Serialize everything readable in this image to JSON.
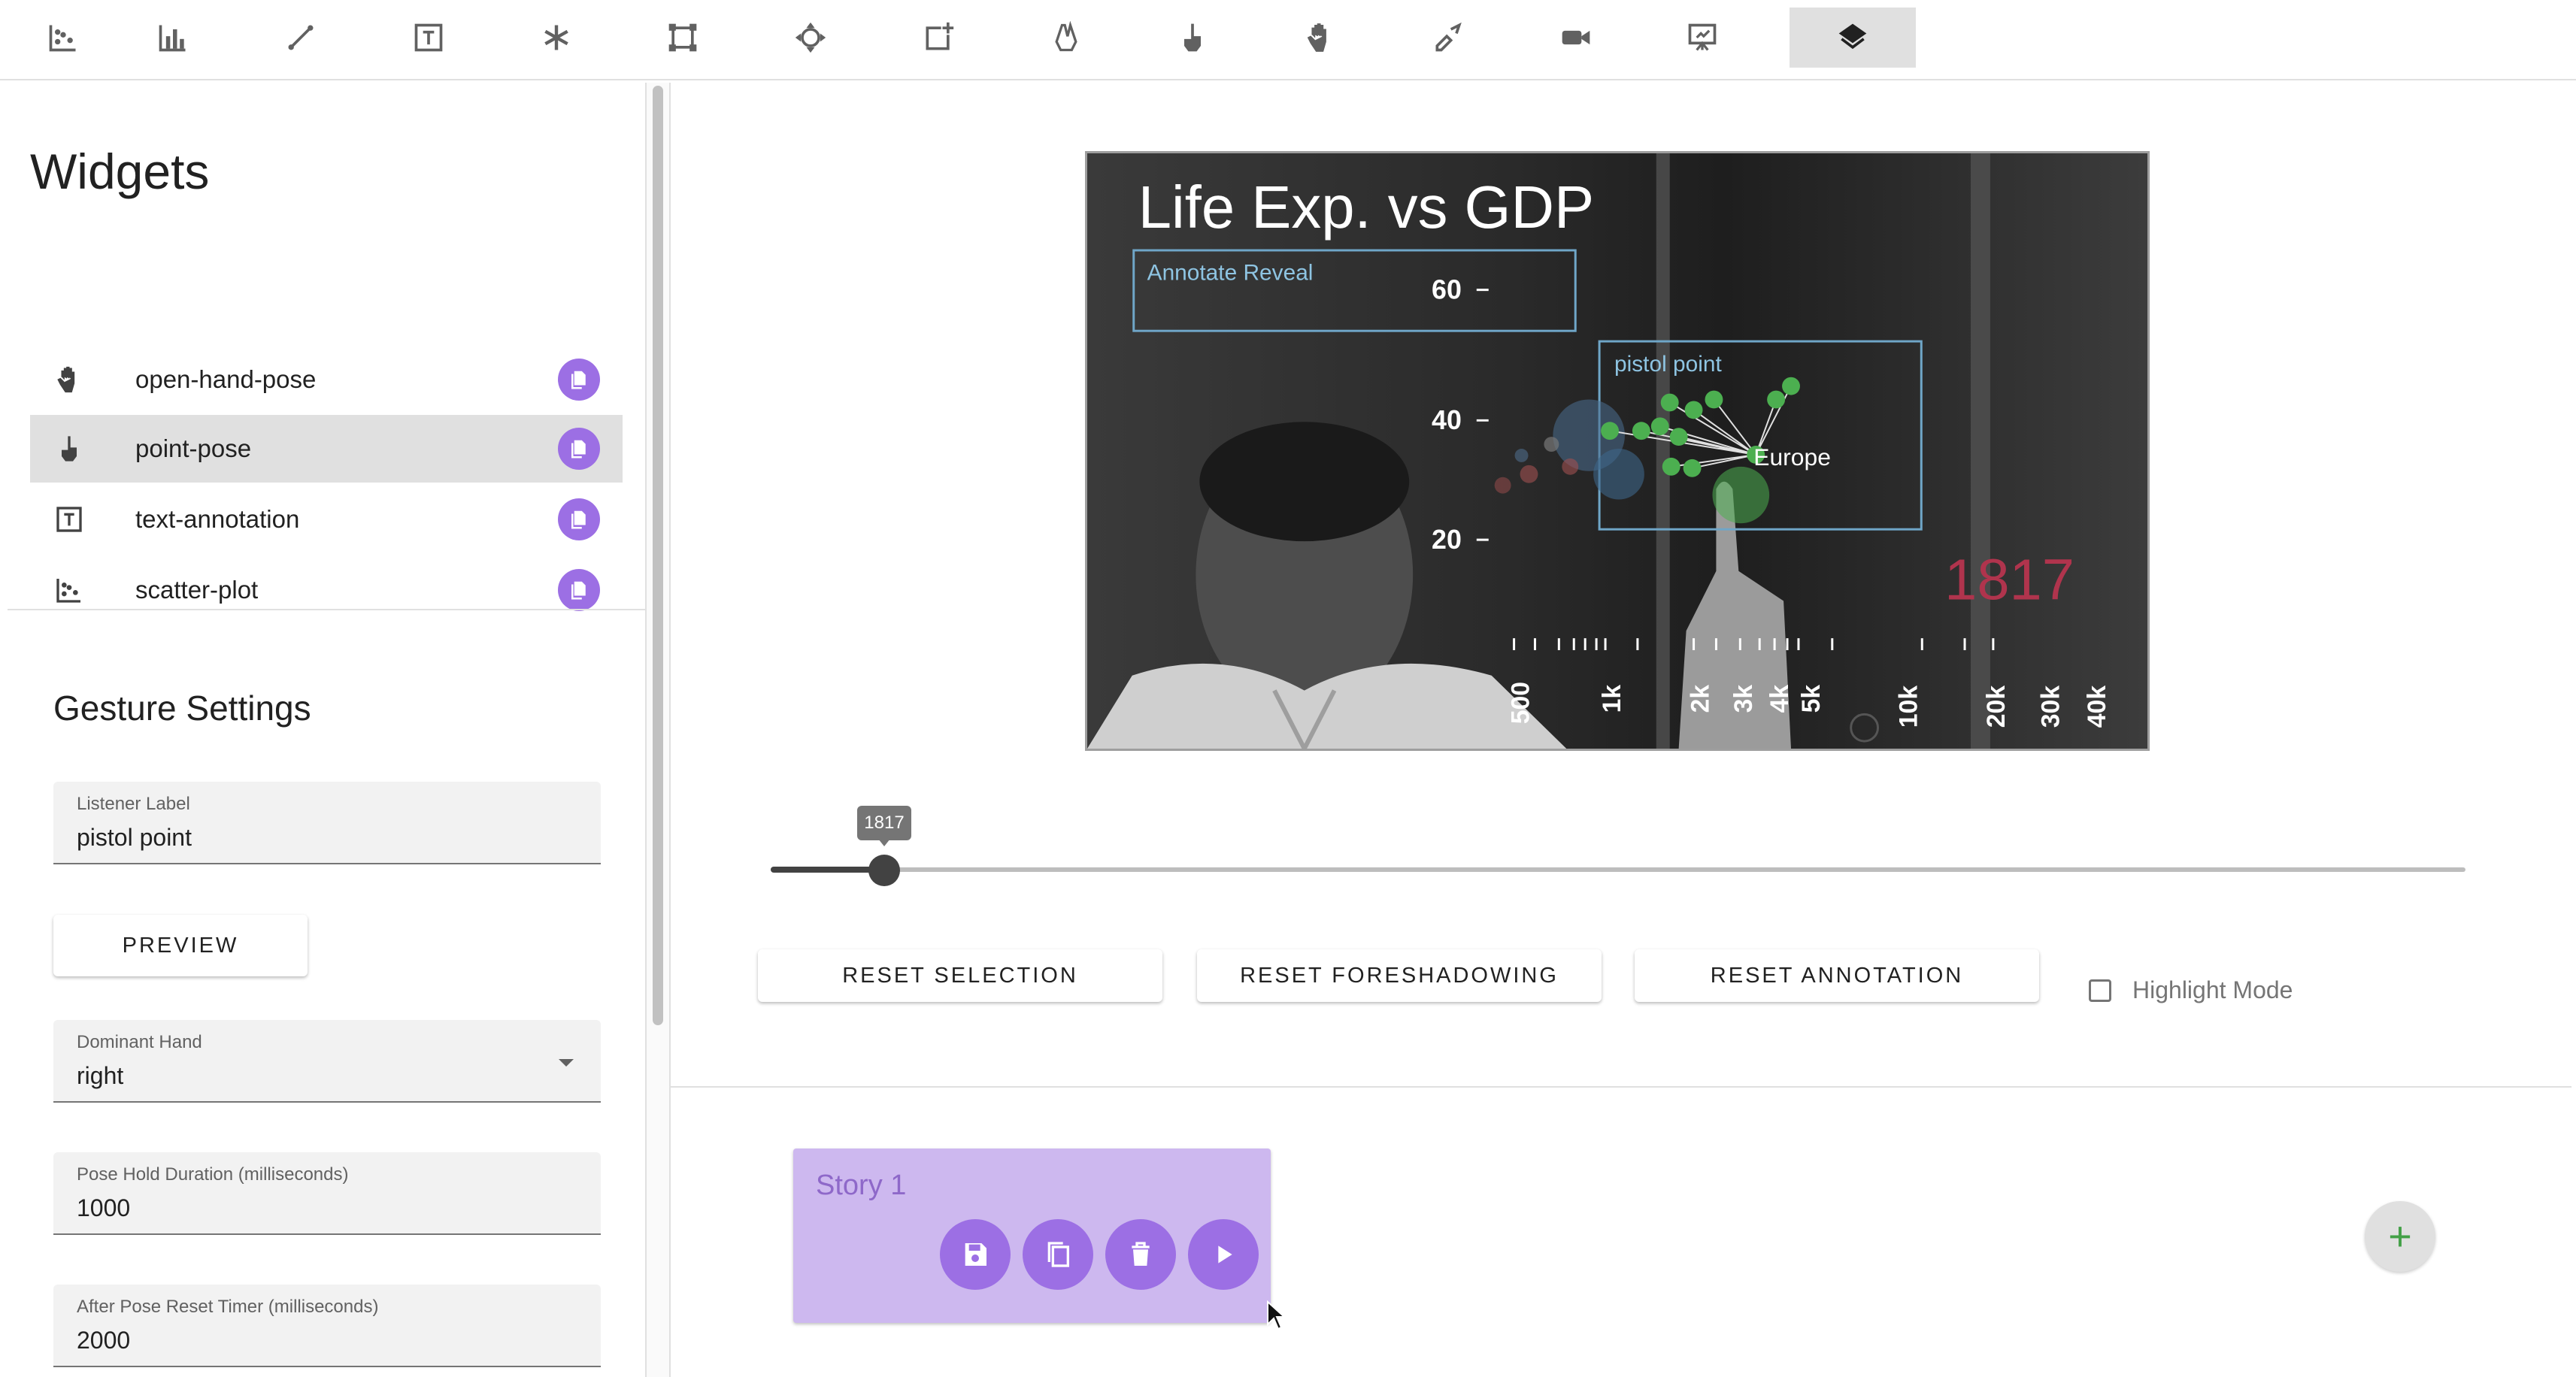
{
  "toolbar": {
    "tools": [
      {
        "name": "scatter-plot-tool",
        "icon": "scatter-plot-icon"
      },
      {
        "name": "bar-chart-tool",
        "icon": "bar-chart-icon"
      },
      {
        "name": "line-tool",
        "icon": "line-icon"
      },
      {
        "name": "text-tool",
        "icon": "text-box-icon"
      },
      {
        "name": "asterisk-tool",
        "icon": "asterisk-icon"
      },
      {
        "name": "shape-tool",
        "icon": "shape-icon"
      },
      {
        "name": "move-tool",
        "icon": "move-icon"
      },
      {
        "name": "add-box-tool",
        "icon": "add-box-icon"
      },
      {
        "name": "pinch-tool",
        "icon": "pinch-hand-icon"
      },
      {
        "name": "point-pose-tool",
        "icon": "point-hand-icon"
      },
      {
        "name": "open-hand-tool",
        "icon": "open-hand-icon"
      },
      {
        "name": "swipe-tool",
        "icon": "swipe-hand-icon"
      },
      {
        "name": "video-tool",
        "icon": "video-camera-icon"
      },
      {
        "name": "presentation-tool",
        "icon": "presentation-icon"
      },
      {
        "name": "layers-tool",
        "icon": "layers-icon",
        "active": true
      }
    ]
  },
  "sidebar": {
    "title": "Widgets",
    "widgets": [
      {
        "label": "open-hand-pose",
        "icon": "open-hand-icon"
      },
      {
        "label": "point-pose",
        "icon": "point-hand-icon",
        "selected": true
      },
      {
        "label": "text-annotation",
        "icon": "text-box-icon"
      },
      {
        "label": "scatter-plot",
        "icon": "scatter-plot-icon"
      }
    ],
    "gesture_settings": {
      "title": "Gesture Settings",
      "listener_label": {
        "label": "Listener Label",
        "value": "pistol point"
      },
      "preview_button": "PREVIEW",
      "dominant_hand": {
        "label": "Dominant Hand",
        "value": "right"
      },
      "pose_hold_duration": {
        "label": "Pose Hold Duration (milliseconds)",
        "value": "1000"
      },
      "after_pose_reset": {
        "label": "After Pose Reset Timer (milliseconds)",
        "value": "2000"
      }
    }
  },
  "video": {
    "chart_title": "Life Exp. vs GDP",
    "annotation_box_label": "Annotate Reveal",
    "pistol_box_label": "pistol point",
    "highlight_label": "Europe",
    "year": "1817",
    "y_ticks": [
      "60",
      "40",
      "20"
    ],
    "x_ticks": [
      "500",
      "1k",
      "2k",
      "3k",
      "4k",
      "5k",
      "10k",
      "20k",
      "30k",
      "40k"
    ]
  },
  "slider": {
    "value": "1817",
    "position": 0.066
  },
  "buttons": {
    "reset_selection": "RESET SELECTION",
    "reset_foreshadowing": "RESET FORESHADOWING",
    "reset_annotation": "RESET ANNOTATION"
  },
  "highlight_mode": {
    "label": "Highlight Mode",
    "checked": false
  },
  "story": {
    "title": "Story 1"
  },
  "colors": {
    "accent": "#9c6fe4",
    "story_bg": "#cdb8ef",
    "fab_plus": "#43a047",
    "year": "#b0344d",
    "box": "#6fa6c8",
    "dots": "#4caf50"
  }
}
